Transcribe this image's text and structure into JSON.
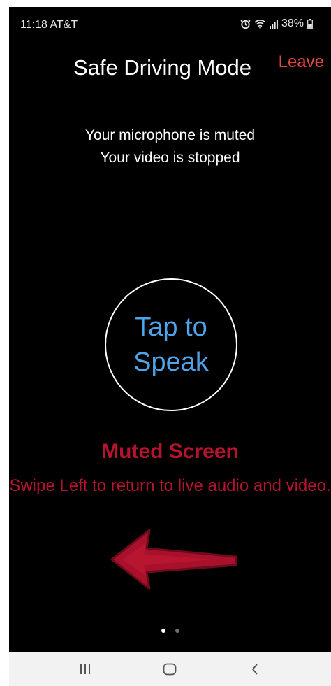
{
  "status_bar": {
    "time": "11:18",
    "carrier": "AT&T",
    "battery": "38%",
    "icons": [
      "alarm-icon",
      "wifi-icon",
      "signal-icon",
      "battery-icon"
    ]
  },
  "header": {
    "title": "Safe Driving Mode",
    "leave_label": "Leave"
  },
  "status_messages": {
    "microphone": "Your microphone is muted",
    "video": "Your video is stopped"
  },
  "tap_to_speak": {
    "line1": "Tap to",
    "line2": "Speak"
  },
  "annotation": {
    "title": "Muted Screen",
    "text": "Swipe Left to return to live audio and video.",
    "arrow_icon": "left-arrow-icon"
  },
  "pager": {
    "count": 2,
    "active_index": 0
  },
  "nav_bar": {
    "buttons": [
      "recent-apps-icon",
      "home-icon",
      "back-icon"
    ]
  },
  "colors": {
    "background": "#000000",
    "leave": "#e0483b",
    "tap_text": "#4fa3e8",
    "annotation": "#b5132e"
  }
}
